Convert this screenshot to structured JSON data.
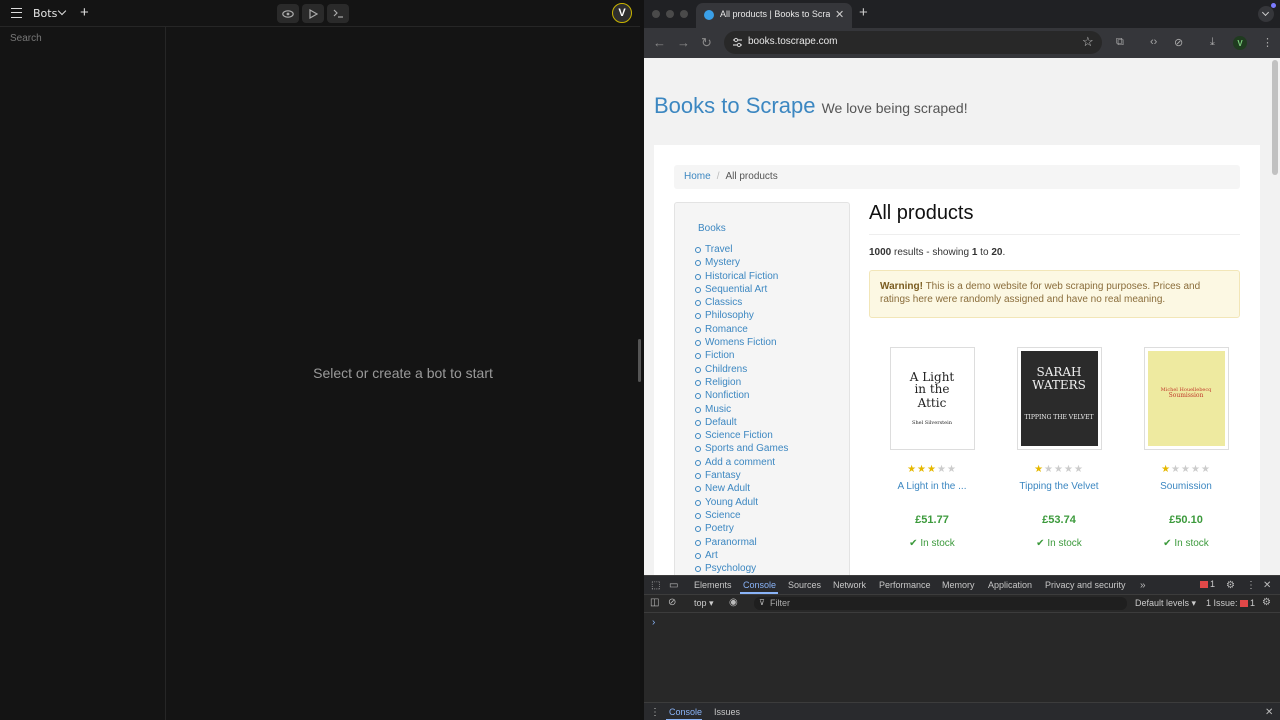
{
  "left_app": {
    "bots_label": "Bots",
    "search": {
      "placeholder": "Search",
      "value": ""
    },
    "empty_message": "Select or create a bot to start",
    "avatar_initial": "V"
  },
  "browser": {
    "tab_title": "All products | Books to Scrape",
    "url": "books.toscrape.com",
    "profile_initial": "V"
  },
  "site": {
    "title": "Books to Scrape",
    "tagline": "We love being scraped!",
    "breadcrumb": {
      "home": "Home",
      "current": "All products"
    },
    "sidebar_header": "Books",
    "categories": [
      "Travel",
      "Mystery",
      "Historical Fiction",
      "Sequential Art",
      "Classics",
      "Philosophy",
      "Romance",
      "Womens Fiction",
      "Fiction",
      "Childrens",
      "Religion",
      "Nonfiction",
      "Music",
      "Default",
      "Science Fiction",
      "Sports and Games",
      "Add a comment",
      "Fantasy",
      "New Adult",
      "Young Adult",
      "Science",
      "Poetry",
      "Paranormal",
      "Art",
      "Psychology"
    ],
    "heading": "All products",
    "results": {
      "total": "1000",
      "text1": " results - showing ",
      "from": "1",
      "text2": " to ",
      "to": "20",
      "end": "."
    },
    "warning": {
      "bold": "Warning!",
      "text": " This is a demo website for web scraping purposes. Prices and ratings here were randomly assigned and have no real meaning."
    },
    "products": [
      {
        "title": "A Light in the ...",
        "price": "£51.77",
        "stock": "In stock",
        "rating": 3,
        "cover_line1": "A Light",
        "cover_line2": "in the",
        "cover_line3": "Attic",
        "cover_author": "Shel Silverstein"
      },
      {
        "title": "Tipping the Velvet",
        "price": "£53.74",
        "stock": "In stock",
        "rating": 1,
        "cover_line1": "SARAH",
        "cover_line2": "WATERS",
        "cover_line3": "TIPPING THE VELVET",
        "cover_author": ""
      },
      {
        "title": "Soumission",
        "price": "£50.10",
        "stock": "In stock",
        "rating": 1,
        "cover_line1": "Michel Houellebecq",
        "cover_line2": "Soumission",
        "cover_line3": "",
        "cover_author": ""
      }
    ]
  },
  "devtools": {
    "tabs": [
      "Elements",
      "Console",
      "Sources",
      "Network",
      "Performance",
      "Memory",
      "Application",
      "Privacy and security"
    ],
    "active_tab": "Console",
    "error_count": "1",
    "context": "top",
    "filter_placeholder": "Filter",
    "levels": "Default levels",
    "issues_label": "1 Issue:",
    "issues_count": "1",
    "prompt": "›",
    "drawer_tabs": [
      "Console",
      "Issues"
    ]
  },
  "colors": {
    "link": "#3c87c1",
    "price": "#3c9a3c",
    "star_on": "#e6b800",
    "devtools_accent": "#8ab4f8"
  }
}
